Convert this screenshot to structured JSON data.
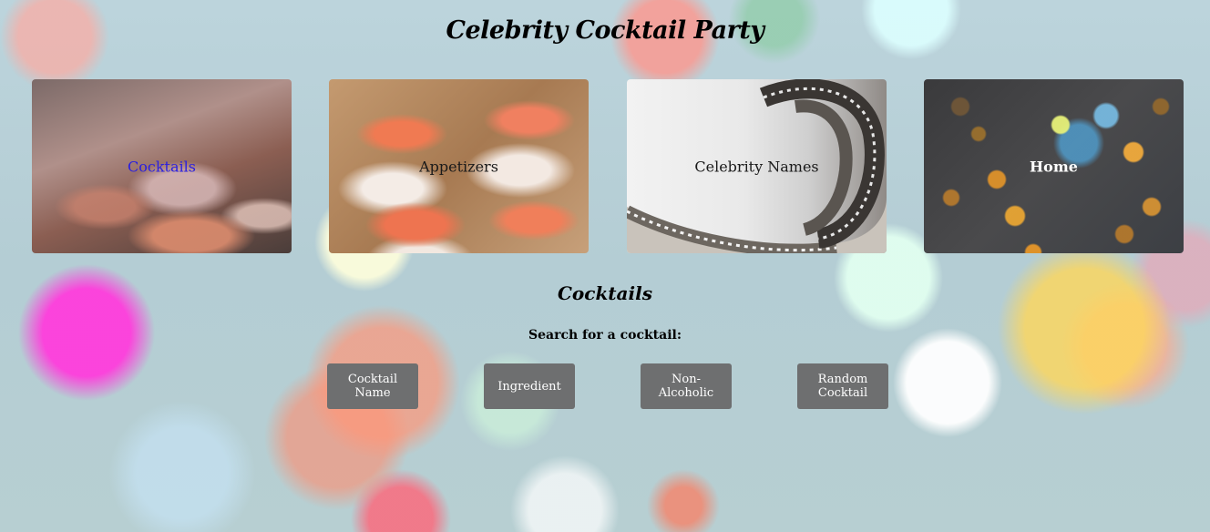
{
  "site": {
    "title": "Celebrity Cocktail Party"
  },
  "nav": {
    "cards": [
      {
        "label": "Cocktails"
      },
      {
        "label": "Appetizers"
      },
      {
        "label": "Celebrity Names"
      },
      {
        "label": "Home"
      }
    ],
    "active_label_color": "#2a1fe0"
  },
  "section": {
    "title": "Cocktails",
    "search_label": "Search for a cocktail:"
  },
  "buttons": {
    "cocktail_name": "Cocktail Name",
    "ingredient": "Ingredient",
    "non_alcoholic": "Non-Alcoholic",
    "random_cocktail": "Random Cocktail"
  },
  "colors": {
    "button_bg": "#6e6f70",
    "button_text": "#ffffff"
  }
}
